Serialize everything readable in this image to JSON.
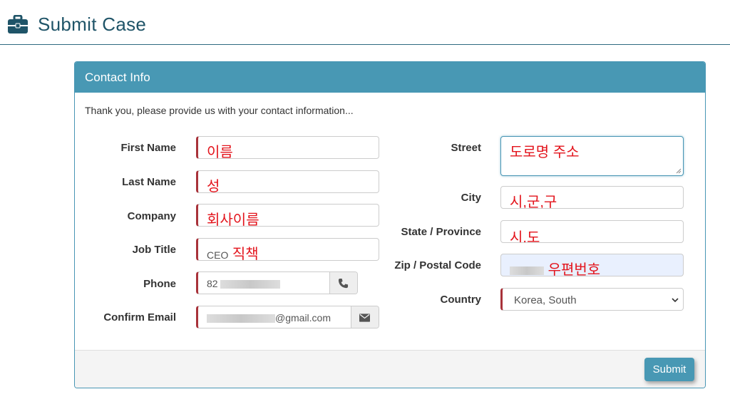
{
  "page": {
    "title": "Submit Case",
    "icon": "briefcase-icon"
  },
  "panel": {
    "heading": "Contact Info",
    "intro": "Thank you, please provide us with your contact information...",
    "submit_label": "Submit"
  },
  "form": {
    "first_name": {
      "label": "First Name",
      "value": "이름"
    },
    "last_name": {
      "label": "Last Name",
      "value": "성"
    },
    "company": {
      "label": "Company",
      "value": "회사이름"
    },
    "job_title": {
      "label": "Job Title",
      "prefix": "CEO",
      "value": "직책"
    },
    "phone": {
      "label": "Phone",
      "value": "82",
      "icon": "phone-icon"
    },
    "confirm_email": {
      "label": "Confirm Email",
      "value": "@gmail.com",
      "icon": "envelope-icon"
    },
    "street": {
      "label": "Street",
      "value": "도로명 주소"
    },
    "city": {
      "label": "City",
      "value": "시,군,구"
    },
    "state": {
      "label": "State / Province",
      "value": "시,도"
    },
    "zip": {
      "label": "Zip / Postal Code",
      "value": "우편번호"
    },
    "country": {
      "label": "Country",
      "value": "Korea, South"
    }
  },
  "colors": {
    "accent": "#4898b4",
    "required": "#a8323a",
    "annotation": "#e3141c",
    "autofill": "#e9f0fe"
  }
}
